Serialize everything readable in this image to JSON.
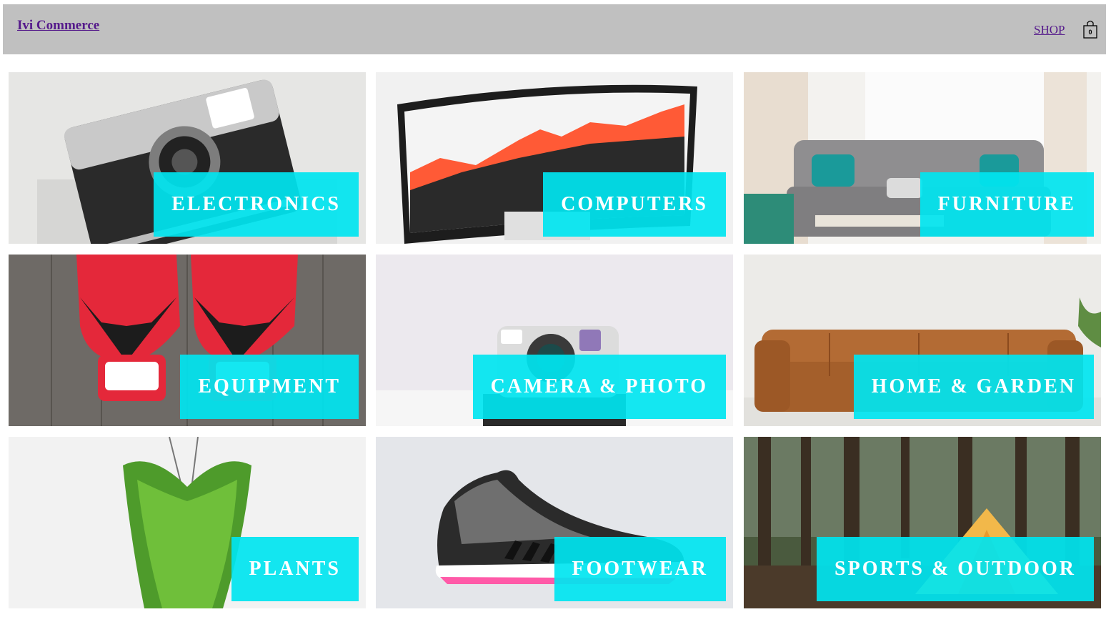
{
  "header": {
    "brand": "Ivi Commerce",
    "shop_link": "SHOP",
    "cart_count": "0"
  },
  "categories": [
    {
      "label": "ELECTRONICS",
      "image": "vintage-camera-photo"
    },
    {
      "label": "COMPUTERS",
      "image": "curved-monitor-photo"
    },
    {
      "label": "FURNITURE",
      "image": "grey-sofa-photo"
    },
    {
      "label": "EQUIPMENT",
      "image": "boxing-gloves-photo"
    },
    {
      "label": "CAMERA & PHOTO",
      "image": "instant-camera-photo"
    },
    {
      "label": "HOME & GARDEN",
      "image": "leather-sofa-photo"
    },
    {
      "label": "PLANTS",
      "image": "hanging-plant-photo"
    },
    {
      "label": "FOOTWEAR",
      "image": "sneaker-photo"
    },
    {
      "label": "SPORTS & OUTDOOR",
      "image": "forest-tent-photo"
    }
  ],
  "colors": {
    "header_bg": "#c0c0c0",
    "link": "#551a8b",
    "label_bg": "#00e5f0",
    "label_text": "#ffffff"
  }
}
